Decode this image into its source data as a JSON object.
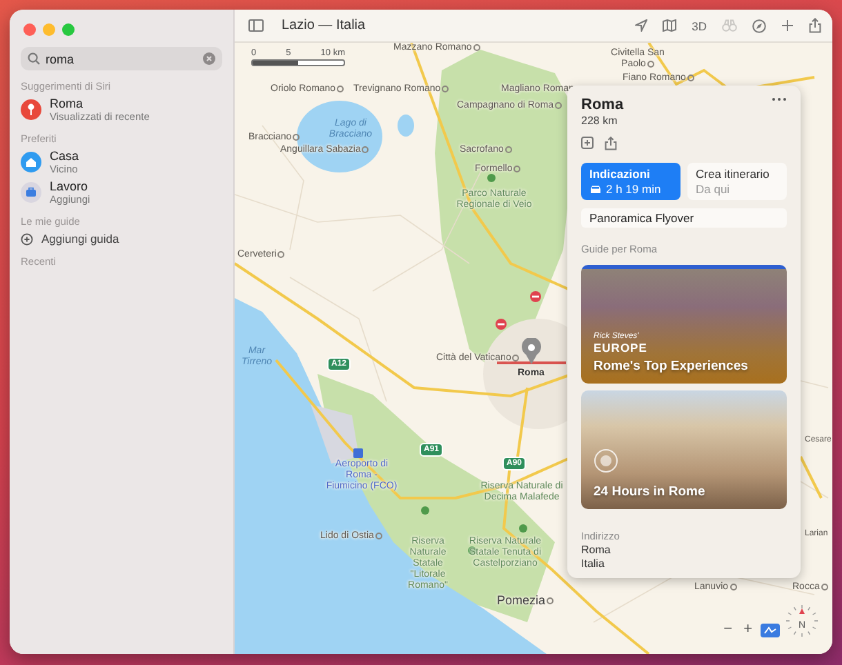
{
  "window": {
    "title": "Lazio — Italia"
  },
  "sidebar": {
    "search": {
      "value": "roma"
    },
    "sections": [
      {
        "title": "Suggerimenti di Siri",
        "items": [
          {
            "kind": "pin",
            "title": "Roma",
            "subtitle": "Visualizzati di recente"
          }
        ]
      },
      {
        "title": "Preferiti",
        "items": [
          {
            "kind": "home",
            "title": "Casa",
            "subtitle": "Vicino"
          },
          {
            "kind": "work",
            "title": "Lavoro",
            "subtitle": "Aggiungi"
          }
        ]
      },
      {
        "title": "Le mie guide",
        "items": [
          {
            "kind": "add",
            "title": "Aggiungi guida"
          }
        ]
      },
      {
        "title": "Recenti"
      }
    ]
  },
  "toolbar": {
    "three_d": "3D",
    "look_around": {
      "disabled": true
    }
  },
  "map": {
    "scale": [
      "0",
      "5",
      "10 km"
    ],
    "labels": [
      {
        "text": "Mazzano Romano",
        "kind": "town"
      },
      {
        "text": "Civitella San Paolo",
        "kind": "town"
      },
      {
        "text": "Fiano Romano",
        "kind": "town"
      },
      {
        "text": "Oriolo Romano",
        "kind": "town"
      },
      {
        "text": "Trevignano Romano",
        "kind": "town"
      },
      {
        "text": "Magliano Roman",
        "kind": "town"
      },
      {
        "text": "Lago di Bracciano",
        "kind": "water"
      },
      {
        "text": "Campagnano di Roma",
        "kind": "town"
      },
      {
        "text": "Bracciano",
        "kind": "town"
      },
      {
        "text": "Anguillara Sabazia",
        "kind": "town"
      },
      {
        "text": "Sacrofano",
        "kind": "town"
      },
      {
        "text": "Formello",
        "kind": "town"
      },
      {
        "text": "Parco Naturale Regionale di Veio",
        "kind": "park"
      },
      {
        "text": "Cerveteri",
        "kind": "town"
      },
      {
        "text": "Mar Tirreno",
        "kind": "water"
      },
      {
        "text": "Città del Vaticano",
        "kind": "town"
      },
      {
        "text": "Roma",
        "kind": "capital"
      },
      {
        "text": "Aeroporto di Roma - Fiumicino (FCO)",
        "kind": "airport"
      },
      {
        "text": "Lido di Ostia",
        "kind": "town"
      },
      {
        "text": "Riserva Naturale Statale \"Litorale Romano\"",
        "kind": "park"
      },
      {
        "text": "Riserva Naturale di Decima Malafede",
        "kind": "park"
      },
      {
        "text": "Riserva Naturale Statale Tenuta di Castelporziano",
        "kind": "park"
      },
      {
        "text": "Pomezia",
        "kind": "large-town"
      },
      {
        "text": "Lanuvio",
        "kind": "town"
      },
      {
        "text": "Rocca",
        "kind": "town"
      },
      {
        "text": "Cesare",
        "kind": "edge"
      },
      {
        "text": "Larian",
        "kind": "edge"
      }
    ],
    "road_shields": [
      "A12",
      "A91",
      "A90"
    ],
    "zoom": [
      "−",
      "+"
    ],
    "compass": "N"
  },
  "place_card": {
    "title": "Roma",
    "distance": "228 km",
    "actions": [
      {
        "kind": "directions",
        "label": "Indicazioni",
        "detail": "2 h 19 min",
        "primary": true
      },
      {
        "kind": "route",
        "label": "Crea itinerario",
        "detail": "Da qui",
        "primary": false
      }
    ],
    "flyover": "Panoramica Flyover",
    "guides_heading": "Guide per Roma",
    "guides": [
      {
        "kind": "publisher-logo",
        "logo": [
          "Rick Steves'",
          "EUROPE"
        ],
        "title": "Rome's Top Experiences"
      },
      {
        "kind": "badge-logo",
        "title": "24 Hours in Rome"
      }
    ],
    "address": {
      "label": "Indirizzo",
      "lines": [
        "Roma",
        "Italia"
      ]
    }
  }
}
